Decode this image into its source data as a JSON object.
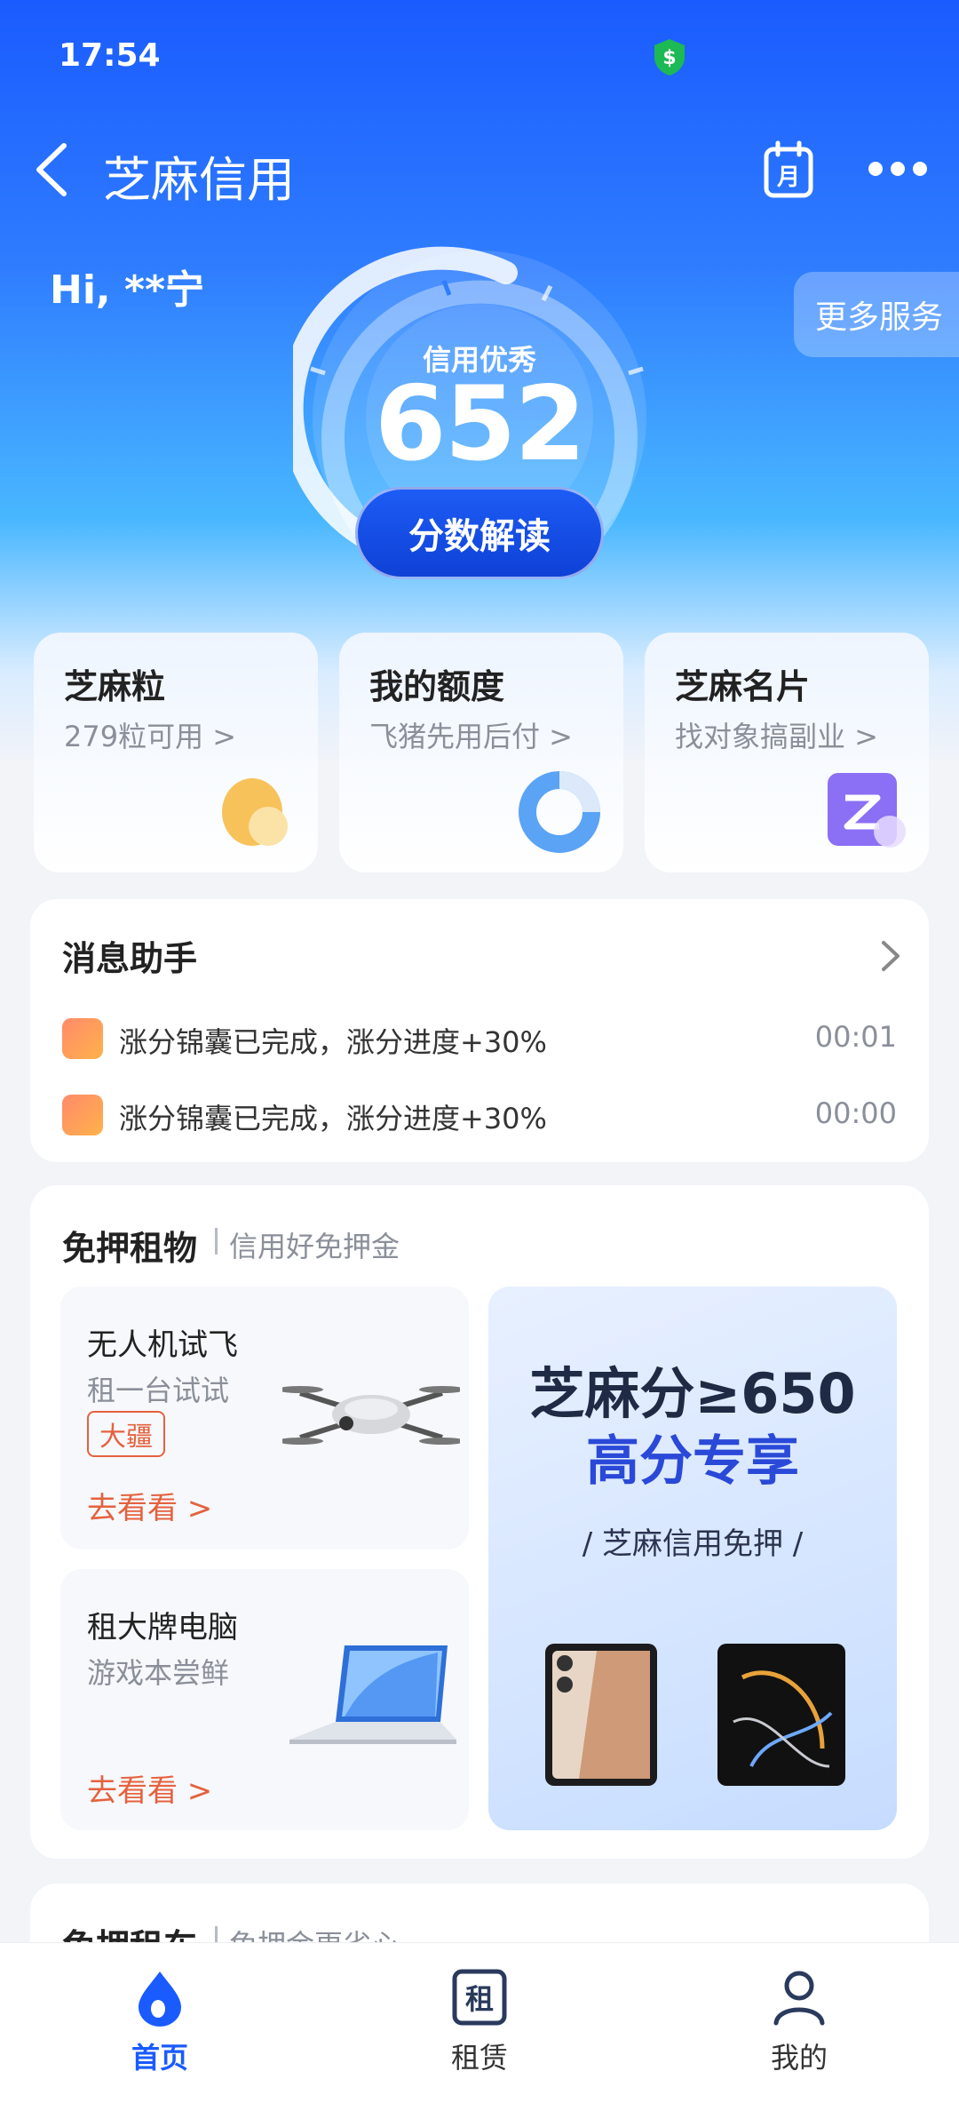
{
  "status_bar": {
    "time": "17:54"
  },
  "header": {
    "title": "芝麻信用"
  },
  "greeting": "Hi, **宁",
  "score_panel": {
    "level": "信用优秀",
    "score": "652",
    "interpret_button": "分数解读"
  },
  "more_services": "更多服务",
  "feature_cards": [
    {
      "title": "芝麻粒",
      "subtitle": "279粒可用 >"
    },
    {
      "title": "我的额度",
      "subtitle": "飞猪先用后付 >"
    },
    {
      "title": "芝麻名片",
      "subtitle": "找对象搞副业 >"
    }
  ],
  "message_assistant": {
    "title": "消息助手",
    "items": [
      {
        "text": "涨分锦囊已完成，涨分进度+30%",
        "time": "00:01"
      },
      {
        "text": "涨分锦囊已完成，涨分进度+30%",
        "time": "00:00"
      }
    ]
  },
  "deposit_free_rental": {
    "title": "免押租物",
    "subtitle": "信用好免押金",
    "items": [
      {
        "name": "无人机试飞",
        "desc": "租一台试试",
        "tag": "大疆",
        "link": "去看看 >"
      },
      {
        "name": "租大牌电脑",
        "desc": "游戏本尝鲜",
        "link": "去看看 >"
      }
    ],
    "promo": {
      "line1": "芝麻分≥650",
      "line2": "高分专享",
      "line3": "/ 芝麻信用免押 /"
    }
  },
  "next_section": {
    "title": "免押租车",
    "subtitle": "免押金更省心"
  },
  "tab_bar": [
    {
      "label": "首页",
      "icon": "home-drop-icon",
      "active": true
    },
    {
      "label": "租赁",
      "icon": "rent-icon",
      "active": false
    },
    {
      "label": "我的",
      "icon": "profile-icon",
      "active": false
    }
  ],
  "colors": {
    "primary": "#1a5bff",
    "accent_orange": "#e4623f",
    "promo_blue": "#2a49d8"
  }
}
